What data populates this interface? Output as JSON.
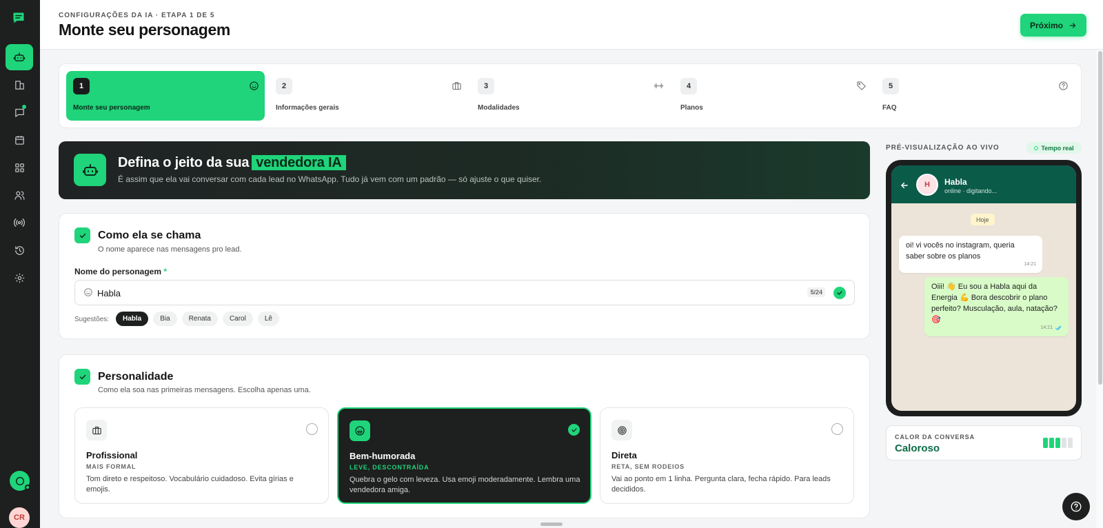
{
  "header": {
    "breadcrumb": "CONFIGURAÇÕES DA IA · ETAPA 1 DE 5",
    "title": "Monte seu personagem",
    "next_label": "Próximo"
  },
  "sidebar": {
    "items": [
      {
        "name": "robot",
        "icon": "robot-icon",
        "active": true
      },
      {
        "name": "dashboard",
        "icon": "bar-chart-icon"
      },
      {
        "name": "conversations",
        "icon": "chat-icon",
        "badge_dot": true
      },
      {
        "name": "calendar",
        "icon": "calendar-icon"
      },
      {
        "name": "apps",
        "icon": "grid-icon"
      },
      {
        "name": "contacts",
        "icon": "users-icon"
      },
      {
        "name": "broadcast",
        "icon": "broadcast-icon"
      },
      {
        "name": "history",
        "icon": "history-icon"
      },
      {
        "name": "settings",
        "icon": "gear-icon"
      }
    ],
    "avatar_initials": "CR"
  },
  "steps": [
    {
      "num": "1",
      "label": "Monte seu personagem",
      "icon": "smile-icon",
      "active": true
    },
    {
      "num": "2",
      "label": "Informações gerais",
      "icon": "briefcase-icon"
    },
    {
      "num": "3",
      "label": "Modalidades",
      "icon": "dumbbell-icon"
    },
    {
      "num": "4",
      "label": "Planos",
      "icon": "tag-icon"
    },
    {
      "num": "5",
      "label": "FAQ",
      "icon": "help-circle-icon"
    }
  ],
  "hero": {
    "title_prefix": "Defina o jeito da sua",
    "title_highlight": "vendedora IA",
    "subtitle": "É assim que ela vai conversar com cada lead no WhatsApp. Tudo já vem com um padrão — só ajuste o que quiser."
  },
  "name_section": {
    "title": "Como ela se chama",
    "subtitle": "O nome aparece nas mensagens pro lead.",
    "field_label": "Nome do personagem",
    "required_mark": "*",
    "value": "Habla",
    "counter": "5/24",
    "suggestions_label": "Sugestões:",
    "suggestions": [
      "Habla",
      "Bia",
      "Renata",
      "Carol",
      "Lê"
    ],
    "selected_suggestion": "Habla"
  },
  "personality": {
    "title": "Personalidade",
    "subtitle": "Como ela soa nas primeiras mensagens. Escolha apenas uma.",
    "options": [
      {
        "title": "Profissional",
        "tag": "MAIS FORMAL",
        "desc": "Tom direto e respeitoso. Vocabulário cuidadoso. Evita gírias e emojis.",
        "icon": "briefcase-icon",
        "selected": false
      },
      {
        "title": "Bem-humorada",
        "tag": "LEVE, DESCONTRAÍDA",
        "desc": "Quebra o gelo com leveza. Usa emoji moderadamente. Lembra uma vendedora amiga.",
        "icon": "laugh-icon",
        "selected": true
      },
      {
        "title": "Direta",
        "tag": "RETA, SEM RODEIOS",
        "desc": "Vai ao ponto em 1 linha. Pergunta clara, fecha rápido. Para leads decididos.",
        "icon": "target-icon",
        "selected": false
      }
    ]
  },
  "preview": {
    "label": "PRÉ-VISUALIZAÇÃO AO VIVO",
    "badge": "Tempo real",
    "contact_initial": "H",
    "contact_name": "Habla",
    "contact_status": "online · digitando...",
    "day": "Hoje",
    "messages": [
      {
        "dir": "in",
        "text": "oi! vi vocês no instagram, queria saber sobre os planos",
        "time": "14:21"
      },
      {
        "dir": "out",
        "text": "Oiii! 👋 Eu sou a Habla aqui da Energia 💪 Bora descobrir o plano perfeito? Musculação, aula, natação? 🎯",
        "time": "14:21"
      }
    ]
  },
  "warmth": {
    "label": "CALOR DA CONVERSA",
    "value": "Caloroso",
    "level_filled": 3,
    "level_total": 5
  },
  "colors": {
    "accent": "#1fd47a",
    "sidebar_bg": "#1e1f1f",
    "whatsapp_header": "#0b5b49"
  }
}
